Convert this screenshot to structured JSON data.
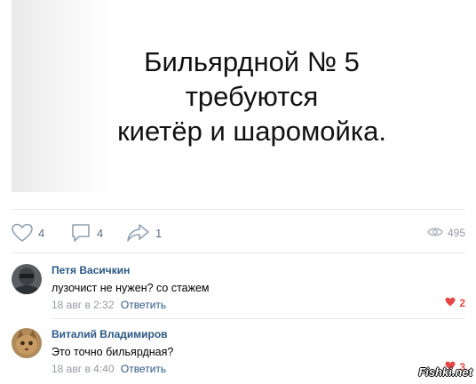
{
  "post": {
    "image_text_lines": [
      "Бильярдной № 5",
      "требуются",
      "киетёр и шаромойка."
    ]
  },
  "actions": {
    "likes": "4",
    "comments": "4",
    "shares": "1",
    "views": "495"
  },
  "comments": [
    {
      "author": "Петя Васичкин",
      "text": "лузочист не нужен? со стажем",
      "date": "18 авг в 2:32",
      "reply": "Ответить",
      "likes": "2"
    },
    {
      "author": "Виталий Владимиров",
      "text": "Это точно бильярдная?",
      "date": "18 авг в 4:40",
      "reply": "Ответить",
      "likes": "3"
    }
  ],
  "watermark": "Fishki.net",
  "colors": {
    "link": "#2a5885",
    "muted": "#939aa3",
    "icon": "#8fa1b3",
    "like_red": "#e64646",
    "divider": "#e7e8ec"
  }
}
